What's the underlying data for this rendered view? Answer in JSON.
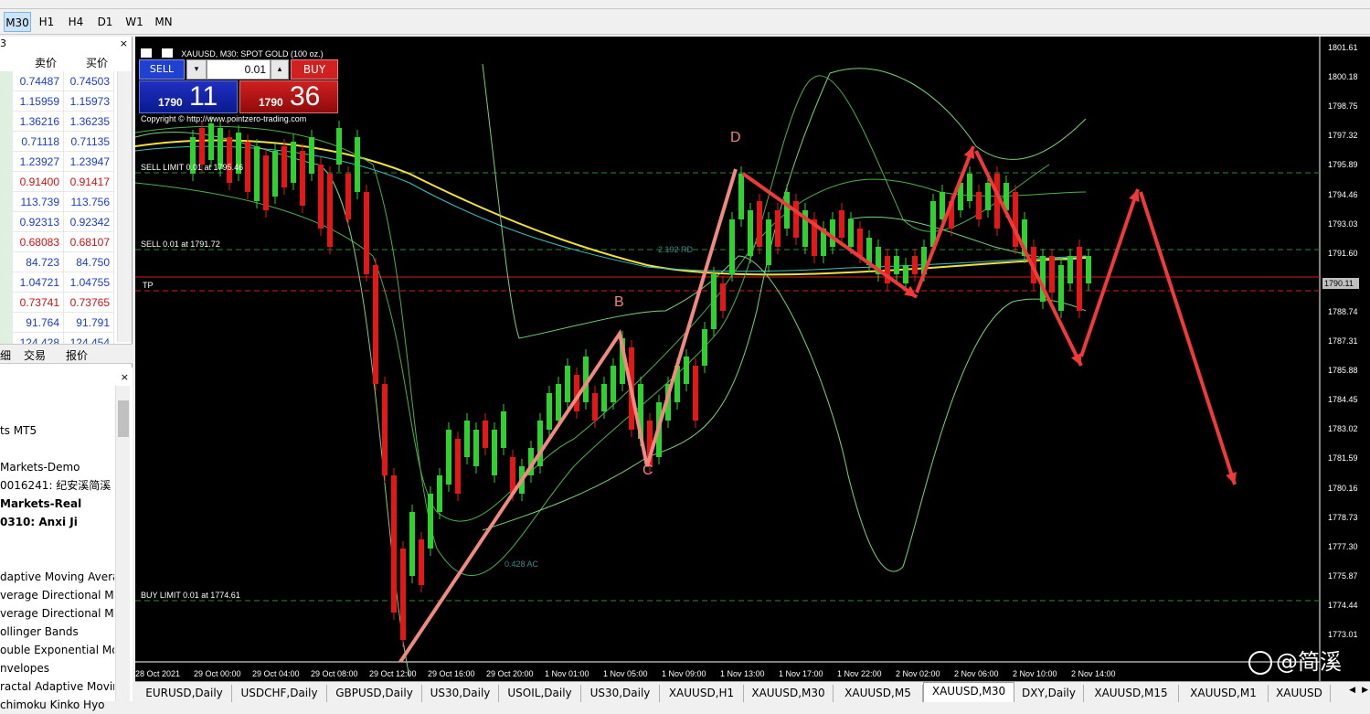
{
  "timeframes": [
    "M30",
    "H1",
    "H4",
    "D1",
    "W1",
    "MN"
  ],
  "active_timeframe": "M30",
  "market_watch": {
    "close": "×",
    "col_bid": "卖价",
    "col_ask": "买价",
    "rows": [
      {
        "bid": "0.74487",
        "ask": "0.74503",
        "color": "#1a3cc8"
      },
      {
        "bid": "1.15959",
        "ask": "1.15973",
        "color": "#1a3cc8"
      },
      {
        "bid": "1.36216",
        "ask": "1.36235",
        "color": "#1a3cc8"
      },
      {
        "bid": "0.71118",
        "ask": "0.71135",
        "color": "#1a3cc8"
      },
      {
        "bid": "1.23927",
        "ask": "1.23947",
        "color": "#1a3cc8"
      },
      {
        "bid": "0.91400",
        "ask": "0.91417",
        "color": "#d01010"
      },
      {
        "bid": "113.739",
        "ask": "113.756",
        "color": "#1a3cc8"
      },
      {
        "bid": "0.92313",
        "ask": "0.92342",
        "color": "#1a3cc8"
      },
      {
        "bid": "0.68083",
        "ask": "0.68107",
        "color": "#d01010"
      },
      {
        "bid": "84.723",
        "ask": "84.750",
        "color": "#1a3cc8"
      },
      {
        "bid": "1.04721",
        "ask": "1.04755",
        "color": "#1a3cc8"
      },
      {
        "bid": "0.73741",
        "ask": "0.73765",
        "color": "#d01010"
      },
      {
        "bid": "91.764",
        "ask": "91.791",
        "color": "#1a3cc8"
      },
      {
        "bid": "124.428",
        "ask": "124.454",
        "color": "#1a3cc8"
      }
    ],
    "tabs": [
      "细",
      "交易",
      "报价"
    ]
  },
  "navigator": {
    "close": "×",
    "items": [
      "ts MT5",
      "",
      "Markets-Demo",
      "0016241: 纪安溪简溪",
      "Markets-Real",
      "0310: Anxi Ji",
      "",
      "",
      "daptive Moving Avera",
      "verage Directional Mo",
      "verage Directional Mo",
      "ollinger Bands",
      "ouble Exponential Mo",
      "nvelopes",
      "ractal Adaptive Movin",
      "chimoku Kinko Hyo"
    ]
  },
  "chart": {
    "header": "XAUUSD, M30:  SPOT GOLD (100 oz.)",
    "trade": {
      "sell_label": "SELL",
      "buy_label": "BUY",
      "lot": "0.01",
      "sell_small": "1790",
      "sell_big": "11",
      "buy_small": "1790",
      "buy_big": "36"
    },
    "copyright": "Copyright © http://www.pointzero-trading.com",
    "levels": {
      "sell_limit": "SELL LIMIT 0.01 at 1795.46",
      "sell": "SELL 0.01 at 1791.72",
      "tp": "TP",
      "buy_limit": "BUY LIMIT 0.01 at 1774.61"
    },
    "pattern_labels": {
      "b": "B",
      "c": "C",
      "d": "D"
    },
    "annotations": {
      "rd": "2.192 RD",
      "ac": "0.428 AC"
    },
    "current_price": "1790.11",
    "price_axis": [
      "1801.61",
      "1800.18",
      "1798.75",
      "1797.32",
      "1795.89",
      "1794.46",
      "1793.03",
      "1791.60",
      "1790.11",
      "1788.74",
      "1787.31",
      "1785.88",
      "1784.45",
      "1783.02",
      "1781.59",
      "1780.16",
      "1778.73",
      "1777.30",
      "1775.87",
      "1774.44",
      "1773.01"
    ],
    "time_axis": [
      "28 Oct 2021",
      "29 Oct 00:00",
      "29 Oct 04:00",
      "29 Oct 08:00",
      "29 Oct 12:00",
      "29 Oct 16:00",
      "29 Oct 20:00",
      "1 Nov 01:00",
      "1 Nov 05:00",
      "1 Nov 09:00",
      "1 Nov 13:00",
      "1 Nov 17:00",
      "1 Nov 22:00",
      "2 Nov 02:00",
      "2 Nov 06:00",
      "2 Nov 10:00",
      "2 Nov 14:00"
    ],
    "watermark": "@简溪"
  },
  "bottom_tabs": [
    "EURUSD,Daily",
    "USDCHF,Daily",
    "GBPUSD,Daily",
    "US30,Daily",
    "USOIL,Daily",
    "US30,Daily",
    "XAUUSD,H1",
    "XAUUSD,M30",
    "XAUUSD,M5",
    "XAUUSD,M30",
    "DXY,Daily",
    "XAUUSD,M15",
    "XAUUSD,M1",
    "XAUUSD"
  ],
  "active_bottom_tab": 9
}
